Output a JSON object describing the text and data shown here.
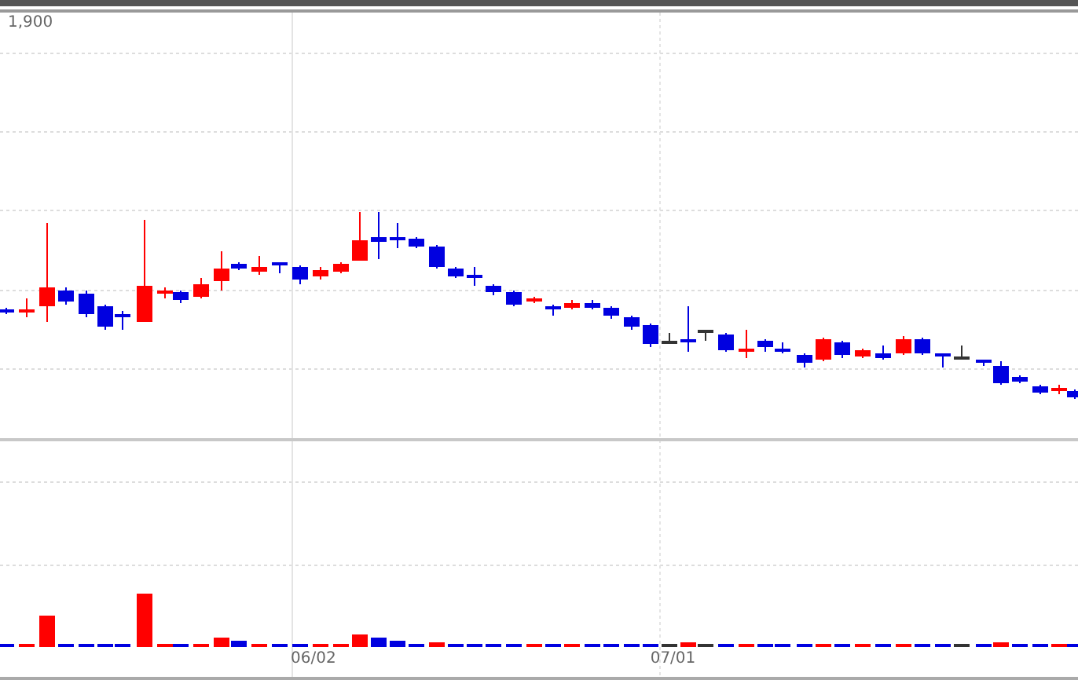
{
  "price_panel": {
    "top_label": "1,900"
  },
  "x_axis": {
    "labels": [
      "06/02",
      "07/01"
    ]
  }
}
